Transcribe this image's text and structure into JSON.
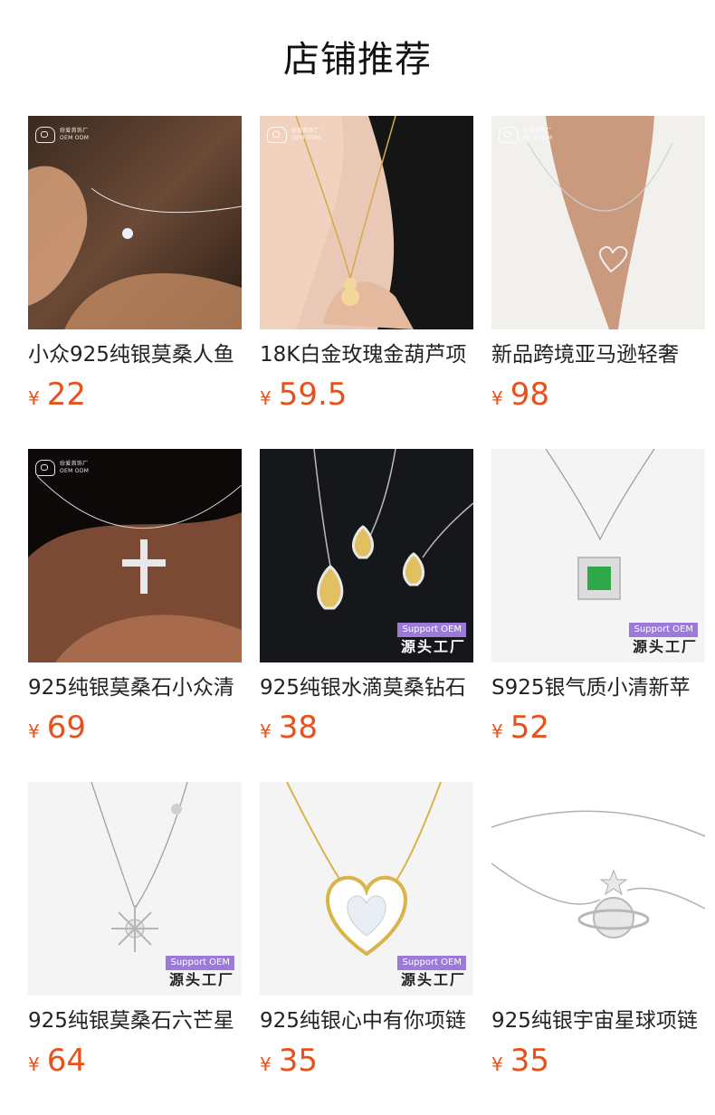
{
  "page": {
    "title": "店铺推荐"
  },
  "brand": {
    "logo_text_top": "纷爱首饰厂",
    "logo_text_bottom": "OEM ODM"
  },
  "badge": {
    "support": "Support OEM",
    "factory": "源头工厂"
  },
  "products": [
    {
      "name": "小众925纯银莫桑人鱼",
      "currency": "¥",
      "price": "22"
    },
    {
      "name": "18K白金玫瑰金葫芦项",
      "currency": "¥",
      "price": "59.5"
    },
    {
      "name": "新品跨境亚马逊轻奢",
      "currency": "¥",
      "price": "98"
    },
    {
      "name": "925纯银莫桑石小众清",
      "currency": "¥",
      "price": "69"
    },
    {
      "name": "925纯银水滴莫桑钻石",
      "currency": "¥",
      "price": "38"
    },
    {
      "name": "S925银气质小清新苹",
      "currency": "¥",
      "price": "52"
    },
    {
      "name": "925纯银莫桑石六芒星",
      "currency": "¥",
      "price": "64"
    },
    {
      "name": "925纯银心中有你项链",
      "currency": "¥",
      "price": "35"
    },
    {
      "name": "925纯银宇宙星球项链",
      "currency": "¥",
      "price": "35"
    }
  ]
}
